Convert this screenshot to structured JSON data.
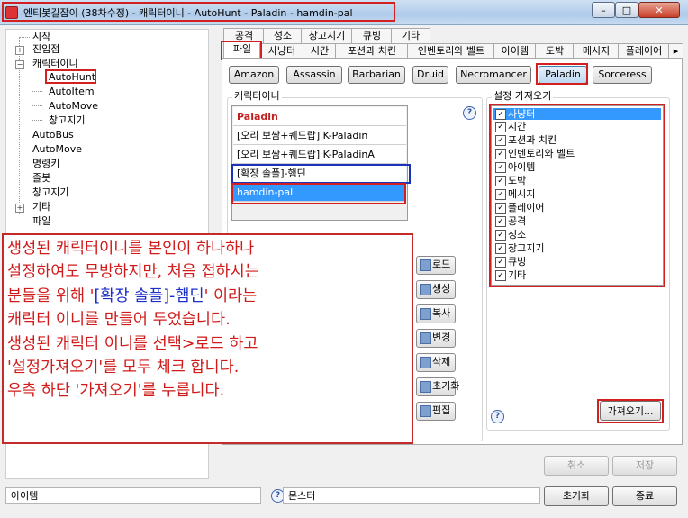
{
  "window": {
    "title": "엔티봇길잡이 (38차수정) - 캐릭터이니 - AutoHunt - Paladin - hamdin-pal",
    "minimize": "–",
    "maximize": "□",
    "close": "✕"
  },
  "tree": {
    "items": [
      {
        "label": "시작"
      },
      {
        "label": "진입점"
      },
      {
        "label": "캐릭터이니"
      },
      {
        "label": "AutoHunt"
      },
      {
        "label": "AutoItem"
      },
      {
        "label": "AutoMove"
      },
      {
        "label": "창고지기"
      },
      {
        "label": "AutoBus"
      },
      {
        "label": "AutoMove"
      },
      {
        "label": "명령키"
      },
      {
        "label": "졸봇"
      },
      {
        "label": "창고지기"
      },
      {
        "label": "기타"
      },
      {
        "label": "파일"
      }
    ]
  },
  "tabs": {
    "row1": [
      "공격",
      "성소",
      "창고지기",
      "큐빙",
      "기타"
    ],
    "row2": [
      "파일",
      "사냥터",
      "시간",
      "포션과 치킨",
      "인벤토리와 벨트",
      "아이템",
      "도박",
      "메시지",
      "플레이어"
    ]
  },
  "classes": [
    "Amazon",
    "Assassin",
    "Barbarian",
    "Druid",
    "Necromancer",
    "Paladin",
    "Sorceress"
  ],
  "character_group": {
    "label": "캐릭터이니",
    "header": "Paladin",
    "rows": [
      "[오리 보쌈+퀘드랍] K-Paladin",
      "[오리 보쌈+퀘드랍] K-PaladinA",
      "[확장 솔플]-햄딘",
      "hamdin-pal"
    ]
  },
  "side_buttons": [
    "로드",
    "생성",
    "복사",
    "변경",
    "삭제",
    "초기화",
    "편집"
  ],
  "settings_group": {
    "label": "설정 가져오기",
    "items": [
      "사냥터",
      "시간",
      "포션과 치킨",
      "인벤토리와 벨트",
      "아이템",
      "도박",
      "메시지",
      "플레이어",
      "공격",
      "성소",
      "창고지기",
      "큐빙",
      "기타"
    ],
    "import_button": "가져오기..."
  },
  "help": "?",
  "bottom": {
    "cancel": "취소",
    "save": "저장",
    "reset": "초기화",
    "exit": "종료"
  },
  "status": {
    "left": "아이템",
    "middle": "몬스터"
  },
  "annotation": {
    "line1": "생성된 캐릭터이니를 본인이 하나하나",
    "line2": "설정하여도 무방하지만, 처음 접하시는",
    "line3_a": "분들을 위해 '",
    "line3_b": "[확장 솔플]-햄딘",
    "line3_c": "' 이라는",
    "line4": "캐릭터 이니를 만들어 두었습니다.",
    "line5": "생성된 캐릭터 이니를 선택>로드 하고",
    "line6": "'설정가져오기'를 모두 체크 합니다.",
    "line7": "우측 하단 '가져오기'를 누릅니다."
  }
}
